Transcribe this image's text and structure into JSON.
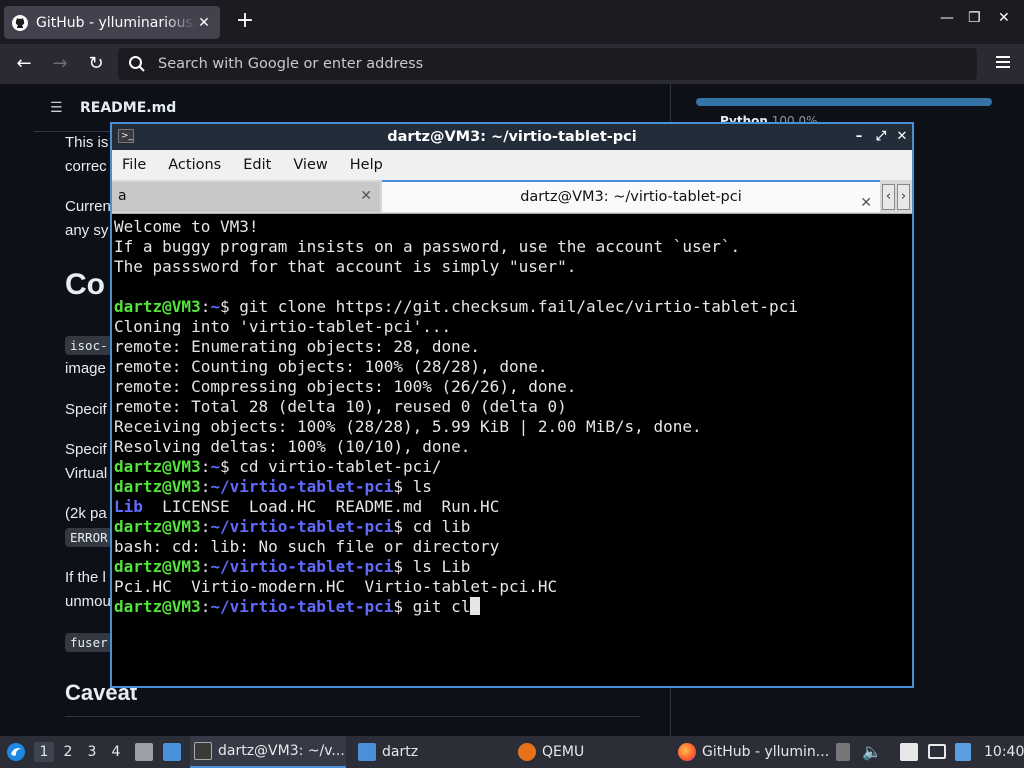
{
  "browser": {
    "tab_title": "GitHub - ylluminarious/re",
    "url_placeholder": "Search with Google or enter address",
    "new_tab": "+"
  },
  "page": {
    "readme_title": "README.md",
    "language_label": "Python",
    "language_pct": "100.0%",
    "para1_a": "This is",
    "para1_b": "correc",
    "para2_a": "Curren",
    "para2_b": "any sy",
    "heading_co": "Co",
    "code_isoc": "isoc-",
    "para_image": "image",
    "para_specif1": "Specif",
    "para_specif2": "Specif",
    "para_virtual": "Virtual",
    "para_2k": "(2k pa",
    "code_error": "ERROR",
    "para_ifthe": "If the l",
    "para_unmou": "unmou",
    "code_fuser": "fuser",
    "heading_caveat": "Caveat"
  },
  "terminal": {
    "title": "dartz@VM3: ~/virtio-tablet-pci",
    "menu": [
      "File",
      "Actions",
      "Edit",
      "View",
      "Help"
    ],
    "tab1_label": "a",
    "tab2_label": "dartz@VM3: ~/virtio-tablet-pci",
    "lines": {
      "l1": "Welcome to VM3!",
      "l2": "If a buggy program insists on a password, use the account `user`.",
      "l3": "The passsword for that account is simply \"user\".",
      "l4": "",
      "p_user": "dartz@VM3",
      "p_home": "~",
      "p_dir": "~/virtio-tablet-pci",
      "cmd1": "$ git clone https://git.checksum.fail/alec/virtio-tablet-pci",
      "o1": "Cloning into 'virtio-tablet-pci'...",
      "o2": "remote: Enumerating objects: 28, done.",
      "o3": "remote: Counting objects: 100% (28/28), done.",
      "o4": "remote: Compressing objects: 100% (26/26), done.",
      "o5": "remote: Total 28 (delta 10), reused 0 (delta 0)",
      "o6": "Receiving objects: 100% (28/28), 5.99 KiB | 2.00 MiB/s, done.",
      "o7": "Resolving deltas: 100% (10/10), done.",
      "cmd2": "$ cd virtio-tablet-pci/",
      "cmd3": "$ ls",
      "ls_dir": "Lib",
      "ls_rest": "  LICENSE  Load.HC  README.md  Run.HC",
      "cmd4": "$ cd lib",
      "o8": "bash: cd: lib: No such file or directory",
      "cmd5": "$ ls Lib",
      "o9": "Pci.HC  Virtio-modern.HC  Virtio-tablet-pci.HC",
      "cmd6": "$ git cl"
    }
  },
  "taskbar": {
    "workspaces": [
      "1",
      "2",
      "3",
      "4"
    ],
    "task_terminal": "dartz@VM3: ~/v...",
    "task_files": "dartz",
    "task_qemu": "QEMU",
    "task_firefox": "GitHub - yllumin...",
    "clock": "10:40"
  }
}
